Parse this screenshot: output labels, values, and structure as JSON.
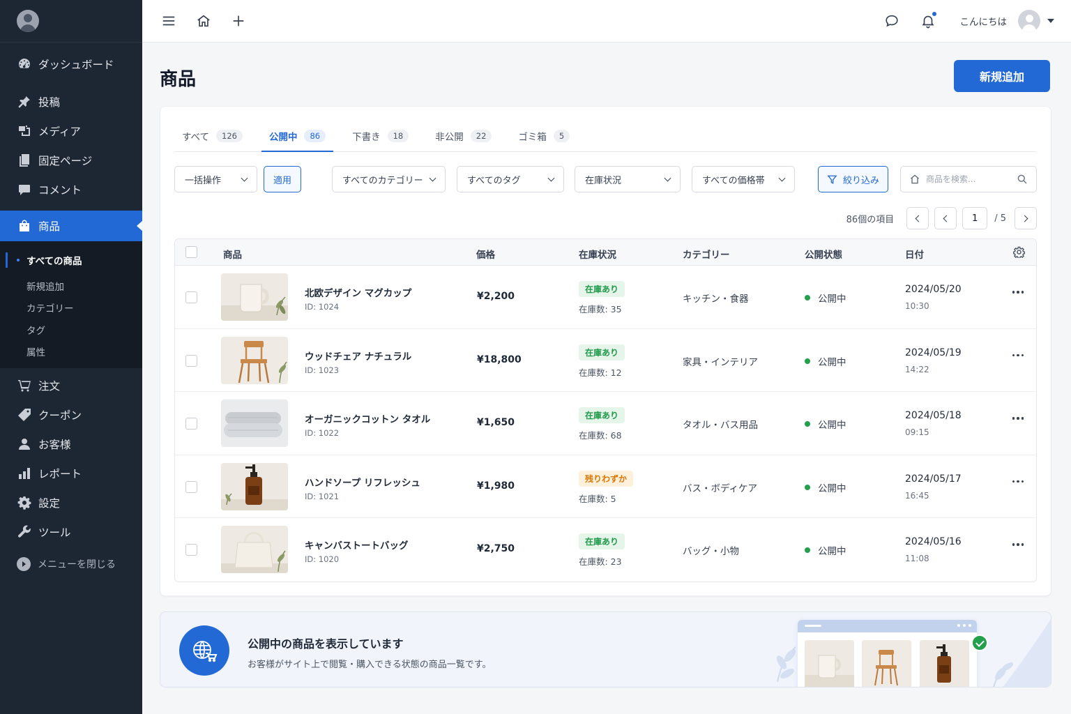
{
  "sidebar": {
    "items": [
      {
        "label": "ダッシュボード",
        "icon": "dashboard-icon"
      },
      {
        "label": "投稿",
        "icon": "pin-icon"
      },
      {
        "label": "メディア",
        "icon": "media-icon"
      },
      {
        "label": "固定ページ",
        "icon": "page-icon"
      },
      {
        "label": "コメント",
        "icon": "comment-icon"
      },
      {
        "label": "商品",
        "icon": "shopping-bag-icon"
      },
      {
        "label": "注文",
        "icon": "cart-icon"
      },
      {
        "label": "クーポン",
        "icon": "tag-icon"
      },
      {
        "label": "お客様",
        "icon": "user-icon"
      },
      {
        "label": "レポート",
        "icon": "bar-chart-icon"
      },
      {
        "label": "設定",
        "icon": "gear-icon"
      },
      {
        "label": "ツール",
        "icon": "wrench-icon"
      }
    ],
    "submenu": [
      "すべての商品",
      "新規追加",
      "カテゴリー",
      "タグ",
      "属性"
    ],
    "collapse_label": "メニューを閉じる"
  },
  "topbar": {
    "greeting": "こんにちは"
  },
  "page": {
    "title": "商品",
    "add_button": "新規追加"
  },
  "tabs": [
    {
      "label": "すべて",
      "count": "126"
    },
    {
      "label": "公開中",
      "count": "86"
    },
    {
      "label": "下書き",
      "count": "18"
    },
    {
      "label": "非公開",
      "count": "22"
    },
    {
      "label": "ゴミ箱",
      "count": "5"
    }
  ],
  "filters": {
    "bulk_action": "一括操作",
    "apply": "適用",
    "category": "すべてのカテゴリー",
    "tag": "すべてのタグ",
    "stock": "在庫状況",
    "price": "すべての価格帯",
    "filter_button": "絞り込み",
    "search_placeholder": "商品を検索..."
  },
  "pagination": {
    "count_label": "86個の項目",
    "current_page": "1",
    "total_pages": "/ 5"
  },
  "table": {
    "headers": {
      "product": "商品",
      "price": "価格",
      "stock": "在庫状況",
      "category": "カテゴリー",
      "status": "公開状態",
      "date": "日付"
    },
    "rows": [
      {
        "name": "北欧デザイン マグカップ",
        "id": "ID: 1024",
        "price": "¥2,200",
        "badge": "在庫あり",
        "badge_type": "in",
        "stock": "在庫数: 35",
        "category": "キッチン・食器",
        "status": "公開中",
        "date": "2024/05/20",
        "time": "10:30",
        "image": "mug"
      },
      {
        "name": "ウッドチェア ナチュラル",
        "id": "ID: 1023",
        "price": "¥18,800",
        "badge": "在庫あり",
        "badge_type": "in",
        "stock": "在庫数: 12",
        "category": "家具・インテリア",
        "status": "公開中",
        "date": "2024/05/19",
        "time": "14:22",
        "image": "chair"
      },
      {
        "name": "オーガニックコットン タオル",
        "id": "ID: 1022",
        "price": "¥1,650",
        "badge": "在庫あり",
        "badge_type": "in",
        "stock": "在庫数: 68",
        "category": "タオル・バス用品",
        "status": "公開中",
        "date": "2024/05/18",
        "time": "09:15",
        "image": "towel"
      },
      {
        "name": "ハンドソープ リフレッシュ",
        "id": "ID: 1021",
        "price": "¥1,980",
        "badge": "残りわずか",
        "badge_type": "low",
        "stock": "在庫数: 5",
        "category": "バス・ボディケア",
        "status": "公開中",
        "date": "2024/05/17",
        "time": "16:45",
        "image": "soap"
      },
      {
        "name": "キャンバストートバッグ",
        "id": "ID: 1020",
        "price": "¥2,750",
        "badge": "在庫あり",
        "badge_type": "in",
        "stock": "在庫数: 23",
        "category": "バッグ・小物",
        "status": "公開中",
        "date": "2024/05/16",
        "time": "11:08",
        "image": "bag"
      }
    ]
  },
  "banner": {
    "title": "公開中の商品を表示しています",
    "text": "お客様がサイト上で閲覧・購入できる状態の商品一覧です。"
  },
  "colors": {
    "accent": "#2369d6",
    "sidebar": "#1d2633",
    "in_stock": "#1f9a4a",
    "low_stock": "#d97706",
    "published_dot": "#22a04b"
  }
}
